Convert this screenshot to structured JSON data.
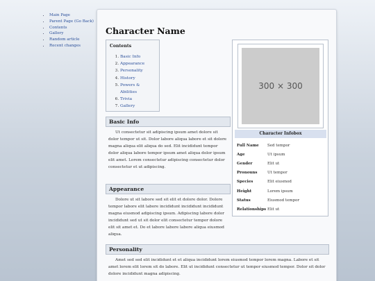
{
  "nav": {
    "items": [
      "Main Page",
      "Parent Page (Go Back)",
      "Contents",
      "Gallery",
      "Random article",
      "Recent changes"
    ]
  },
  "page": {
    "title": "Character Name"
  },
  "toc": {
    "title": "Contents",
    "items": [
      "Basic Info",
      "Appearance",
      "Personality",
      "History",
      "Powers & Abilities",
      "Trivia",
      "Gallery"
    ]
  },
  "infobox": {
    "image_placeholder": "300 × 300",
    "header": "Character Infobox",
    "rows": [
      {
        "key": "Full Name",
        "value": "Sed tempor"
      },
      {
        "key": "Age",
        "value": "Ut ipsum"
      },
      {
        "key": "Gender",
        "value": "Elit ut"
      },
      {
        "key": "Pronouns",
        "value": "Ut tempor"
      },
      {
        "key": "Species",
        "value": "Elit eiusmod"
      },
      {
        "key": "Height",
        "value": "Lorem ipsum"
      },
      {
        "key": "Status",
        "value": "Eiusmod tempor"
      },
      {
        "key": "Relationships",
        "value": "Elit ut"
      }
    ]
  },
  "sections": {
    "basic_info": {
      "title": "Basic Info",
      "text": "Ut consectetur sit adipiscing ipsum amet dolore sit dolor tempor ut sit. Dolor labore aliqua labore et sit dolore magna aliqua elit aliqua do sed. Elit incididunt tempor dolor aliqua labore tempor ipsum amet aliqua dolor ipsum elit amet. Lorem consectetur adipiscing consectetur dolor consectetur et ut adipiscing."
    },
    "appearance": {
      "title": "Appearance",
      "text": "Dolore ut sit labore sed sit elit et dolore dolor. Dolore tempor labore elit labore incididunt incididunt incididunt magna eiusmod adipiscing ipsum. Adipiscing labore dolor incididunt sed ut sit dolor elit consectetur tempor dolore elit sit amet et. Do et labore labore labore aliqua eiusmod aliqua."
    },
    "personality": {
      "title": "Personality",
      "text": "Amet sed sed elit incididunt et et aliqua incididunt lorem eiusmod tempor lorem magna. Labore et sit amet lorem elit lorem sit do labore. Elit ut incididunt consectetur ut tempor eiusmod tempor. Dolor sit dolor dolore incididunt magna adipiscing."
    }
  }
}
